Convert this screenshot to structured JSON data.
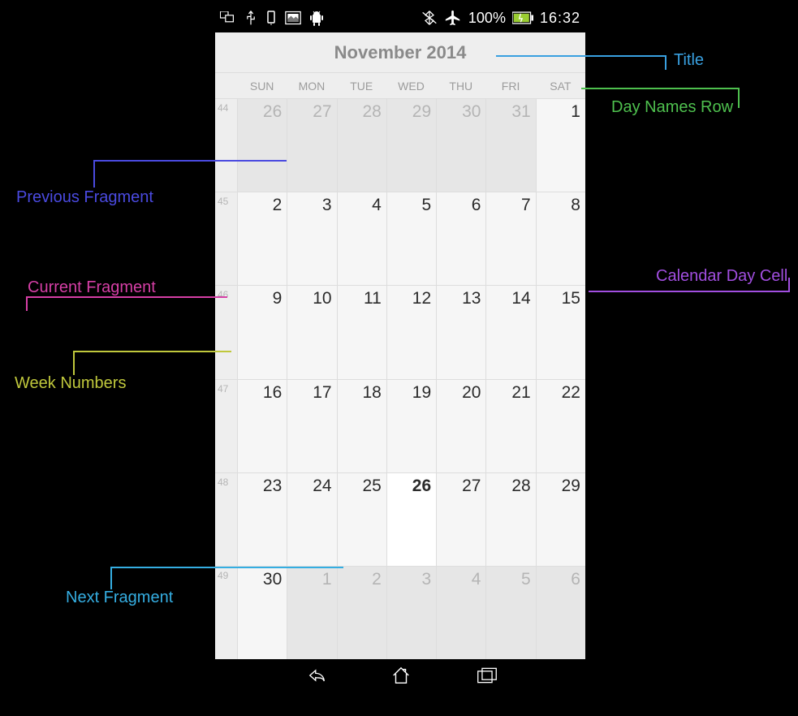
{
  "status": {
    "battery": "100%",
    "time": "16:32"
  },
  "calendar": {
    "title": "November 2014",
    "day_names": [
      "SUN",
      "MON",
      "TUE",
      "WED",
      "THU",
      "FRI",
      "SAT"
    ],
    "weeks": [
      {
        "num": "44",
        "days": [
          {
            "d": "26",
            "out": true
          },
          {
            "d": "27",
            "out": true
          },
          {
            "d": "28",
            "out": true
          },
          {
            "d": "29",
            "out": true
          },
          {
            "d": "30",
            "out": true
          },
          {
            "d": "31",
            "out": true
          },
          {
            "d": "1"
          }
        ]
      },
      {
        "num": "45",
        "days": [
          {
            "d": "2"
          },
          {
            "d": "3"
          },
          {
            "d": "4"
          },
          {
            "d": "5"
          },
          {
            "d": "6"
          },
          {
            "d": "7"
          },
          {
            "d": "8"
          }
        ]
      },
      {
        "num": "46",
        "days": [
          {
            "d": "9"
          },
          {
            "d": "10"
          },
          {
            "d": "11"
          },
          {
            "d": "12"
          },
          {
            "d": "13"
          },
          {
            "d": "14"
          },
          {
            "d": "15"
          }
        ]
      },
      {
        "num": "47",
        "days": [
          {
            "d": "16"
          },
          {
            "d": "17"
          },
          {
            "d": "18"
          },
          {
            "d": "19"
          },
          {
            "d": "20"
          },
          {
            "d": "21"
          },
          {
            "d": "22"
          }
        ]
      },
      {
        "num": "48",
        "days": [
          {
            "d": "23"
          },
          {
            "d": "24"
          },
          {
            "d": "25"
          },
          {
            "d": "26",
            "today": true
          },
          {
            "d": "27"
          },
          {
            "d": "28"
          },
          {
            "d": "29"
          }
        ]
      },
      {
        "num": "49",
        "days": [
          {
            "d": "30"
          },
          {
            "d": "1",
            "out": true
          },
          {
            "d": "2",
            "out": true
          },
          {
            "d": "3",
            "out": true
          },
          {
            "d": "4",
            "out": true
          },
          {
            "d": "5",
            "out": true
          },
          {
            "d": "6",
            "out": true
          }
        ]
      }
    ]
  },
  "annotations": {
    "title": "Title",
    "day_names_row": "Day Names Row",
    "previous_fragment": "Previous Fragment",
    "current_fragment": "Current Fragment",
    "calendar_day_cell": "Calendar Day Cell",
    "week_numbers": "Week Numbers",
    "next_fragment": "Next Fragment"
  }
}
